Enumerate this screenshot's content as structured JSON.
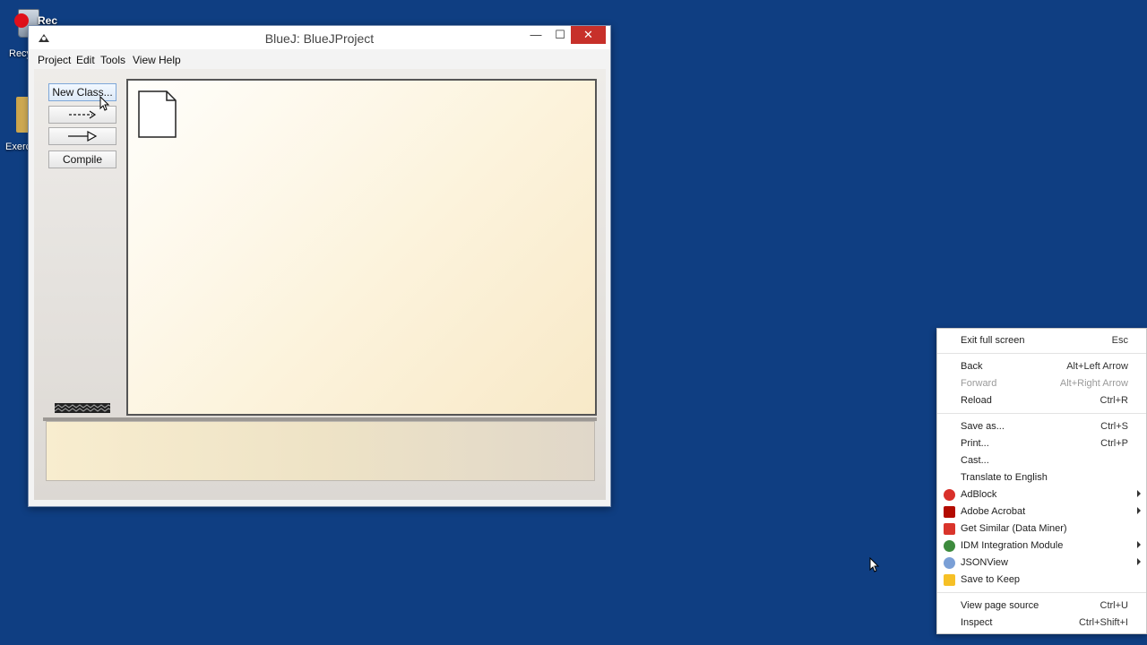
{
  "desktop": {
    "recycle_label": "Recy",
    "folder_label": "Exerci",
    "rec_label": "Rec"
  },
  "window": {
    "title": "BlueJ:  BlueJProject",
    "minimize_glyph": "—",
    "maximize_glyph": "☐",
    "close_glyph": "✕",
    "menu": [
      "Project",
      "Edit",
      "Tools",
      "View",
      "Help"
    ],
    "buttons": {
      "new_class": "New Class...",
      "dashed_arrow": "- - ->",
      "solid_arrow": "—▷",
      "compile": "Compile"
    }
  },
  "context_menu": {
    "items": [
      {
        "label": "Exit full screen",
        "shortcut": "Esc"
      },
      {
        "label": "Back",
        "shortcut": "Alt+Left Arrow"
      },
      {
        "label": "Forward",
        "shortcut": "Alt+Right Arrow",
        "disabled": true
      },
      {
        "label": "Reload",
        "shortcut": "Ctrl+R"
      },
      {
        "label": "Save as...",
        "shortcut": "Ctrl+S"
      },
      {
        "label": "Print...",
        "shortcut": "Ctrl+P"
      },
      {
        "label": "Cast..."
      },
      {
        "label": "Translate to English"
      },
      {
        "label": "AdBlock",
        "icon": "adblock-icon",
        "submenu": true
      },
      {
        "label": "Adobe Acrobat",
        "icon": "acrobat-icon",
        "submenu": true
      },
      {
        "label": "Get Similar (Data Miner)",
        "icon": "data-miner-icon"
      },
      {
        "label": "IDM Integration Module",
        "icon": "idm-icon",
        "submenu": true
      },
      {
        "label": "JSONView",
        "icon": "jsonview-icon",
        "submenu": true
      },
      {
        "label": "Save to Keep",
        "icon": "keep-icon"
      },
      {
        "label": "View page source",
        "shortcut": "Ctrl+U"
      },
      {
        "label": "Inspect",
        "shortcut": "Ctrl+Shift+I"
      }
    ]
  },
  "colors": {
    "desktop_bg": "#0f3e82",
    "close_button": "#c7302a",
    "canvas_bg": "#fcf3dc",
    "adblock": "#d9302a",
    "acrobat": "#b30b00",
    "data_miner": "#d9342b",
    "idm": "#3d8b3d",
    "jsonview": "#7a9fd6",
    "keep": "#f6c026"
  }
}
